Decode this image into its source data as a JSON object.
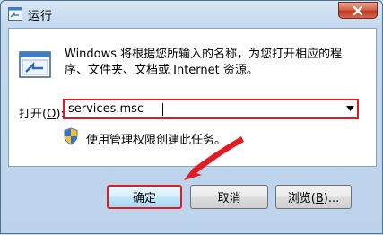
{
  "window": {
    "title": "运行",
    "close_symbol": "close-icon"
  },
  "dialog": {
    "description": "Windows 将根据您所输入的名称，为您打开相应的程序、文件夹、文档或 Internet 资源。",
    "open_label_prefix": "打开(",
    "open_label_mnemonic": "O",
    "open_label_suffix": "):",
    "open_value": "services.msc",
    "admin_notice": "使用管理权限创建此任务。"
  },
  "buttons": {
    "ok": "确定",
    "cancel": "取消",
    "browse_prefix": "浏览(",
    "browse_mnemonic": "B",
    "browse_suffix": ")..."
  },
  "colors": {
    "highlight": "#e21b23",
    "titlebar": "#c3d8ee"
  }
}
